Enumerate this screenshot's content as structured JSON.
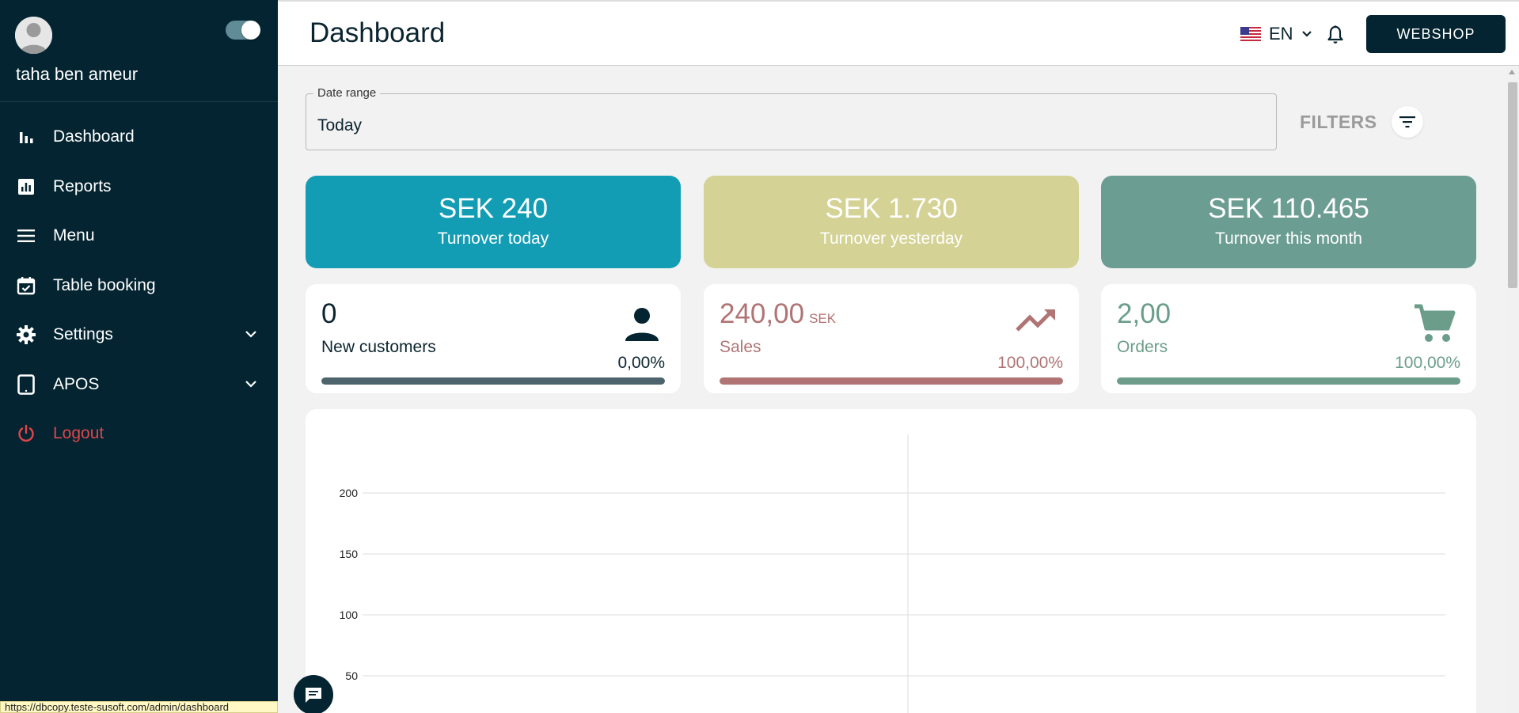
{
  "sidebar": {
    "user_name": "taha ben ameur",
    "items": [
      {
        "label": "Dashboard",
        "icon": "bar-chart-icon"
      },
      {
        "label": "Reports",
        "icon": "report-icon"
      },
      {
        "label": "Menu",
        "icon": "menu-icon"
      },
      {
        "label": "Table booking",
        "icon": "calendar-icon"
      },
      {
        "label": "Settings",
        "icon": "gear-icon"
      },
      {
        "label": "APOS",
        "icon": "tablet-icon"
      },
      {
        "label": "Logout",
        "icon": "power-icon"
      }
    ]
  },
  "header": {
    "title": "Dashboard",
    "language": "EN",
    "webshop_label": "WEBSHOP"
  },
  "filters": {
    "date_range_label": "Date range",
    "date_range_value": "Today",
    "filters_label": "FILTERS"
  },
  "turnover": [
    {
      "amount": "SEK 240",
      "caption": "Turnover today",
      "color": "#139db4"
    },
    {
      "amount": "SEK 1.730",
      "caption": "Turnover yesterday",
      "color": "#d5d295"
    },
    {
      "amount": "SEK 110.465",
      "caption": "Turnover this month",
      "color": "#6b9d93"
    }
  ],
  "stats": {
    "customers": {
      "value": "0",
      "label": "New customers",
      "percent": "0,00%",
      "progress": 1.0,
      "color": "#4d646c"
    },
    "sales": {
      "value": "240,00",
      "unit": "SEK",
      "label": "Sales",
      "percent": "100,00%",
      "progress": 1.0,
      "color": "#b07474"
    },
    "orders": {
      "value": "2,00",
      "label": "Orders",
      "percent": "100,00%",
      "progress": 1.0,
      "color": "#6b9d8a"
    }
  },
  "chart_data": {
    "type": "line",
    "y_ticks": [
      "200",
      "150",
      "100",
      "50"
    ],
    "ylim": [
      50,
      200
    ],
    "grid": true
  },
  "statusbar": {
    "url": "https://dbcopy.teste-susoft.com/admin/dashboard"
  },
  "colors": {
    "sidebar_bg": "#032430",
    "logout": "#e0454b",
    "webshop_bg": "#032430"
  }
}
